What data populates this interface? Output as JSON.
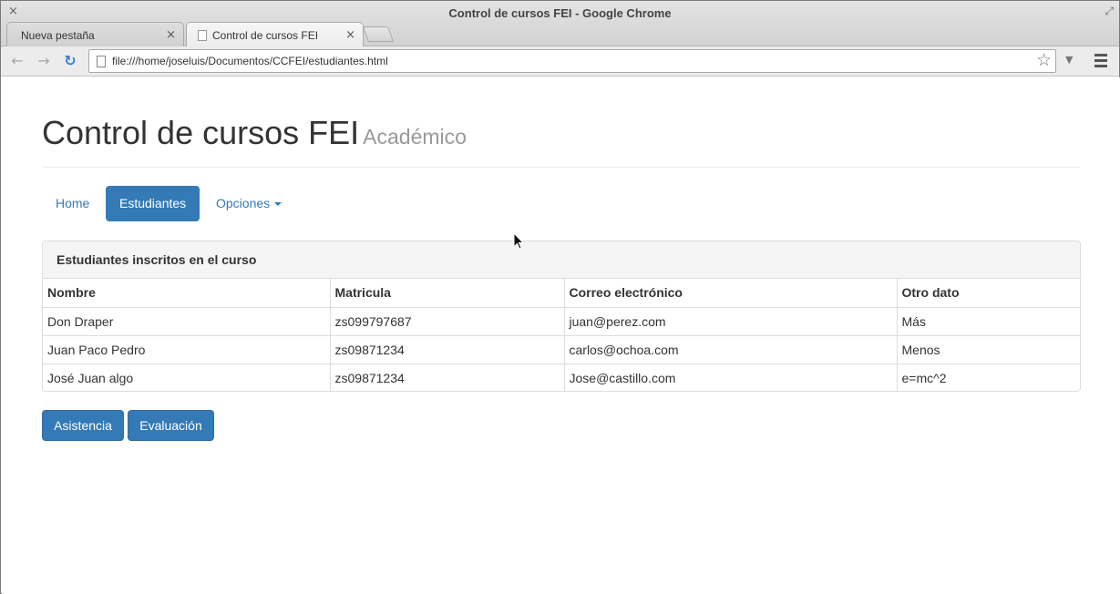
{
  "window": {
    "title": "Control de cursos FEI - Google Chrome",
    "close_glyph": "×",
    "maximize_glyph": "⤢"
  },
  "tabs": [
    {
      "label": "Nueva pestaña",
      "close_glyph": "×"
    },
    {
      "label": "Control de cursos FEI",
      "close_glyph": "×"
    }
  ],
  "toolbar": {
    "back_glyph": "←",
    "forward_glyph": "→",
    "reload_glyph": "↻",
    "url": "file:///home/joseluis/Documentos/CCFEI/estudiantes.html",
    "star_glyph": "☆",
    "dropdown_glyph": "▼"
  },
  "page": {
    "title": "Control de cursos FEI",
    "subtitle": "Académico"
  },
  "nav": {
    "items": [
      {
        "label": "Home",
        "active": false
      },
      {
        "label": "Estudiantes",
        "active": true
      },
      {
        "label": "Opciones",
        "active": false
      }
    ]
  },
  "panel": {
    "heading": "Estudiantes inscritos en el curso",
    "columns": [
      "Nombre",
      "Matricula",
      "Correo electrónico",
      "Otro dato"
    ],
    "rows": [
      [
        "Don Draper",
        "zs099797687",
        "juan@perez.com",
        "Más"
      ],
      [
        "Juan Paco Pedro",
        "zs09871234",
        "carlos@ochoa.com",
        "Menos"
      ],
      [
        "José Juan algo",
        "zs09871234",
        "Jose@castillo.com",
        "e=mc^2"
      ]
    ]
  },
  "actions": {
    "asistencia_label": "Asistencia",
    "evaluacion_label": "Evaluación"
  },
  "colors": {
    "primary": "#337ab7",
    "panel_heading_bg": "#f5f5f5"
  }
}
